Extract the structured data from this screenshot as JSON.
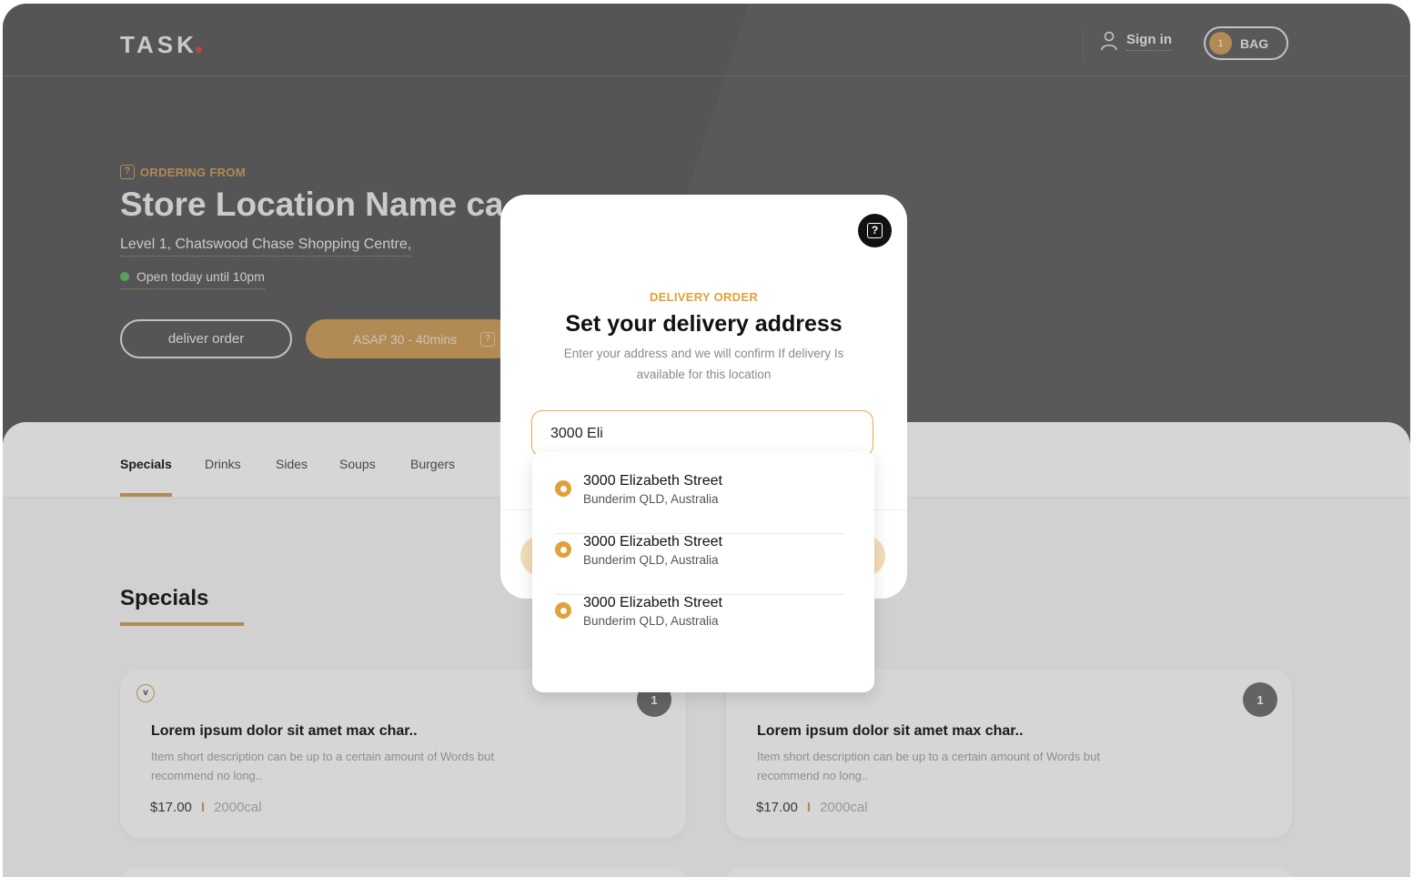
{
  "header": {
    "logo": "TASK",
    "sign_in": "Sign in",
    "bag_label": "BAG",
    "bag_count": "1"
  },
  "store": {
    "ordering_from": "ORDERING FROM",
    "name": "Store Location Name ca",
    "address": "Level 1, Chatswood Chase Shopping Centre,",
    "hours": "Open today until 10pm",
    "deliver_button": "deliver order",
    "asap_button": "ASAP 30 - 40mins"
  },
  "tabs": [
    "Specials",
    "Drinks",
    "Sides",
    "Soups",
    "Burgers"
  ],
  "section_title": "Specials",
  "cards": [
    {
      "badge": "v",
      "count": "1",
      "title": "Lorem ipsum dolor sit amet max char..",
      "desc": "Item short description can be up to a certain amount of Words but recommend no long..",
      "price": "$17.00",
      "separator": "I",
      "calories": "2000cal"
    },
    {
      "badge": "",
      "count": "1",
      "title": "Lorem ipsum dolor sit amet max char..",
      "desc": "Item short description can be up to a certain amount of Words but recommend no long..",
      "price": "$17.00",
      "separator": "I",
      "calories": "2000cal"
    }
  ],
  "modal": {
    "help_glyph": "?",
    "kicker": "DELIVERY ORDER",
    "title": "Set your delivery address",
    "description": "Enter your address and we will confirm If delivery Is available for this location",
    "input_value": "3000 Eli",
    "suggestions": [
      {
        "title": "3000 Elizabeth Street",
        "sub": "Bunderim QLD, Australia"
      },
      {
        "title": "3000 Elizabeth Street",
        "sub": "Bunderim QLD, Australia"
      },
      {
        "title": "3000 Elizabeth Street",
        "sub": "Bunderim QLD, Australia"
      }
    ]
  },
  "colors": {
    "accent": "#d4a565",
    "accent_strong": "#e0a138",
    "open_status": "#6cc06a",
    "logo_dot": "#e0524f"
  },
  "icons": {
    "user": "user-icon",
    "help": "help-icon",
    "pin": "location-pin-icon"
  }
}
